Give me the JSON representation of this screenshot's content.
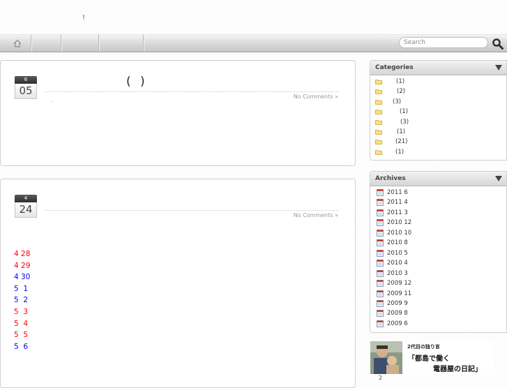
{
  "header": {
    "mark": "!"
  },
  "nav": {
    "tab_count": 4
  },
  "search": {
    "placeholder": "Search"
  },
  "posts": [
    {
      "month": "6",
      "day": "05",
      "title": "( )",
      "comments": "No Comments »",
      "excerpt": "."
    },
    {
      "month": "4",
      "day": "24",
      "title": "",
      "comments": "No Comments »"
    }
  ],
  "schedule": [
    {
      "date": "4 28",
      "color": "#ff0000"
    },
    {
      "date": "4 29",
      "color": "#ff0000"
    },
    {
      "date": "4 30",
      "color": "#0000ff"
    },
    {
      "date": "5  1",
      "color": "#0000ff"
    },
    {
      "date": "5  2",
      "color": "#0000ff"
    },
    {
      "date": "5  3",
      "color": "#ff0000"
    },
    {
      "date": "5  4",
      "color": "#ff0000"
    },
    {
      "date": "5  5",
      "color": "#ff0000"
    },
    {
      "date": "5  6",
      "color": "#0000ff"
    }
  ],
  "categories": {
    "title": "Categories",
    "items": [
      "(1)",
      "(2)",
      "(3)",
      "(1)",
      "(3)",
      "(1)",
      "(21)",
      "(1)"
    ]
  },
  "archives": {
    "title": "Archives",
    "items": [
      "2011 6",
      "2011 4",
      "2011 3",
      "2010 12",
      "2010 10",
      "2010 8",
      "2010 5",
      "2010 4",
      "2010 3",
      "2009 12",
      "2009 11",
      "2009 9",
      "2009 8",
      "2009 6"
    ]
  },
  "banner": {
    "top": "2代目の独り言",
    "line1": "「都島で働く",
    "line2": "電器屋の日記」",
    "caption": "2"
  },
  "colors": {
    "holiday": "#ff0000",
    "workday": "#0000ff"
  }
}
